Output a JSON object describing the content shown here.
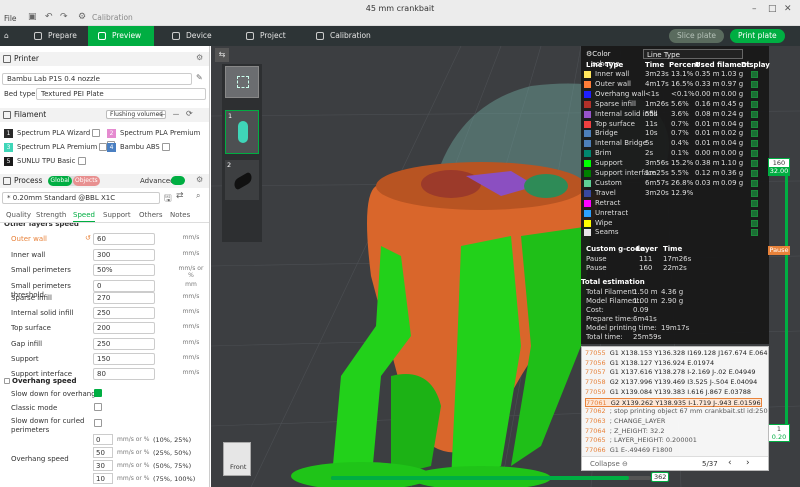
{
  "window": {
    "title": "45 mm crankbait",
    "menu": "File",
    "controls": [
      "–",
      "□",
      "✕"
    ]
  },
  "tabs": [
    {
      "label": "Prepare",
      "active": false
    },
    {
      "label": "Preview",
      "active": true
    },
    {
      "label": "Device",
      "active": false
    },
    {
      "label": "Project",
      "active": false
    },
    {
      "label": "Calibration",
      "active": false
    }
  ],
  "actions": {
    "slice_plate": "Slice plate",
    "print_plate": "Print plate"
  },
  "printer": {
    "section": "Printer",
    "name": "Bambu Lab P1S 0.4 nozzle",
    "bed_type_label": "Bed type",
    "bed_type": "Textured PEI Plate"
  },
  "filament": {
    "section": "Filament",
    "flushing_label": "Flushing volumes",
    "items": [
      {
        "num": "1",
        "name": "Spectrum PLA Wizard",
        "color": "#2a2a2a"
      },
      {
        "num": "2",
        "name": "Spectrum PLA Premium",
        "color": "#e58bd0"
      },
      {
        "num": "3",
        "name": "Spectrum PLA Premium",
        "color": "#3fd6b8"
      },
      {
        "num": "4",
        "name": "Bambu ABS",
        "color": "#4a7fc1"
      },
      {
        "num": "5",
        "name": "SUNLU TPU Basic",
        "color": "#1a1a1a"
      }
    ]
  },
  "process": {
    "section": "Process",
    "toggle_global": "Global",
    "toggle_objects": "Objects",
    "advanced_label": "Advanced",
    "profile": "* 0.20mm Standard @BBL X1C",
    "tabs": [
      "Quality",
      "Strength",
      "Speed",
      "Support",
      "Others",
      "Notes"
    ],
    "active_tab": "Speed"
  },
  "speed": {
    "group": "Other layers speed",
    "rows": [
      {
        "name": "Outer wall",
        "value": "60",
        "unit": "mm/s",
        "modified": true
      },
      {
        "name": "Inner wall",
        "value": "300",
        "unit": "mm/s"
      },
      {
        "name": "Small perimeters",
        "value": "50%",
        "unit": "mm/s or %"
      },
      {
        "name": "Small perimeters threshold",
        "value": "0",
        "unit": "mm"
      },
      {
        "name": "Sparse infill",
        "value": "270",
        "unit": "mm/s"
      },
      {
        "name": "Internal solid infill",
        "value": "250",
        "unit": "mm/s"
      },
      {
        "name": "Top surface",
        "value": "200",
        "unit": "mm/s"
      },
      {
        "name": "Gap infill",
        "value": "250",
        "unit": "mm/s"
      },
      {
        "name": "Support",
        "value": "150",
        "unit": "mm/s"
      },
      {
        "name": "Support interface",
        "value": "80",
        "unit": "mm/s"
      }
    ]
  },
  "overhang": {
    "group": "Overhang speed",
    "slow_down": "Slow down for overhangs",
    "classic": "Classic mode",
    "curled": "Slow down for curled perimeters",
    "label": "Overhang speed",
    "rows": [
      {
        "value": "0",
        "unit": "mm/s or %",
        "range": "(10%, 25%)"
      },
      {
        "value": "50",
        "unit": "mm/s or %",
        "range": "(25%, 50%)"
      },
      {
        "value": "30",
        "unit": "mm/s or %",
        "range": "(50%, 75%)"
      },
      {
        "value": "10",
        "unit": "mm/s or %",
        "range": "(75%, 100%)"
      }
    ]
  },
  "legend": {
    "scheme_label": "Color scheme",
    "scheme": "Line Type",
    "headers": [
      "Line Type",
      "Time",
      "Percent",
      "Used filament",
      "Display"
    ],
    "rows": [
      {
        "name": "Inner wall",
        "time": "3m23s",
        "pct": "13.1%",
        "len": "0.35 m",
        "g": "1.03 g",
        "color": "#ffe65c"
      },
      {
        "name": "Outer wall",
        "time": "4m17s",
        "pct": "16.5%",
        "len": "0.33 m",
        "g": "0.97 g",
        "color": "#ff7d38"
      },
      {
        "name": "Overhang wall",
        "time": "<1s",
        "pct": "<0.1%",
        "len": "0.00 m",
        "g": "0.00 g",
        "color": "#1f1fff"
      },
      {
        "name": "Sparse infill",
        "time": "1m26s",
        "pct": "5.6%",
        "len": "0.16 m",
        "g": "0.45 g",
        "color": "#b03029"
      },
      {
        "name": "Internal solid infill",
        "time": "55s",
        "pct": "3.6%",
        "len": "0.08 m",
        "g": "0.24 g",
        "color": "#9654cc"
      },
      {
        "name": "Top surface",
        "time": "11s",
        "pct": "0.7%",
        "len": "0.01 m",
        "g": "0.04 g",
        "color": "#f04040"
      },
      {
        "name": "Bridge",
        "time": "10s",
        "pct": "0.7%",
        "len": "0.01 m",
        "g": "0.02 g",
        "color": "#4d80ba"
      },
      {
        "name": "Internal Bridge",
        "time": "5s",
        "pct": "0.4%",
        "len": "0.01 m",
        "g": "0.04 g",
        "color": "#4d80ba"
      },
      {
        "name": "Brim",
        "time": "2s",
        "pct": "0.1%",
        "len": "0.00 m",
        "g": "0.00 g",
        "color": "#00876e"
      },
      {
        "name": "Support",
        "time": "3m56s",
        "pct": "15.2%",
        "len": "0.38 m",
        "g": "1.10 g",
        "color": "#00ff00"
      },
      {
        "name": "Support interface",
        "time": "1m25s",
        "pct": "5.5%",
        "len": "0.12 m",
        "g": "0.36 g",
        "color": "#008000"
      },
      {
        "name": "Custom",
        "time": "6m57s",
        "pct": "26.8%",
        "len": "0.03 m",
        "g": "0.09 g",
        "color": "#5ed194"
      },
      {
        "name": "Travel",
        "time": "3m20s",
        "pct": "12.9%",
        "len": "",
        "g": "",
        "color": "#38489e"
      },
      {
        "name": "Retract",
        "time": "",
        "pct": "",
        "len": "",
        "g": "",
        "color": "#ff00ff"
      },
      {
        "name": "Unretract",
        "time": "",
        "pct": "",
        "len": "",
        "g": "",
        "color": "#2ba0ff"
      },
      {
        "name": "Wipe",
        "time": "",
        "pct": "",
        "len": "",
        "g": "",
        "color": "#ffff00"
      },
      {
        "name": "Seams",
        "time": "",
        "pct": "",
        "len": "",
        "g": "",
        "color": "#e6e6e6"
      }
    ],
    "custom_header": [
      "Custom g-code",
      "Layer",
      "Time"
    ],
    "custom": [
      {
        "name": "Pause",
        "layer": "111",
        "time": "17m26s"
      },
      {
        "name": "Pause",
        "layer": "160",
        "time": "22m2s"
      }
    ],
    "estimation_title": "Total estimation",
    "estimation": [
      {
        "k": "Total Filament:",
        "v": "1.50 m",
        "v2": "4.36 g"
      },
      {
        "k": "Model Filament:",
        "v": "1.00 m",
        "v2": "2.90 g"
      },
      {
        "k": "Cost:",
        "v": "0.09",
        "v2": ""
      },
      {
        "k": "Prepare time:",
        "v": "6m41s",
        "v2": ""
      },
      {
        "k": "Model printing time:",
        "v": "19m17s",
        "v2": ""
      },
      {
        "k": "Total time:",
        "v": "25m59s",
        "v2": ""
      }
    ]
  },
  "gcode": {
    "lines": [
      {
        "n": "77055",
        "t": "G1 X138.153 Y136.328 I169.128 J167.674 E.06424"
      },
      {
        "n": "77056",
        "t": "G1 X138.127 Y136.924 E.01974"
      },
      {
        "n": "77057",
        "t": "G1 X137.616 Y138.278 I-2.169 J-.02 E.04949"
      },
      {
        "n": "77058",
        "t": "G2 X137.996 Y139.469 I3.525 J-.504 E.04094"
      },
      {
        "n": "77059",
        "t": "G1 X139.084 Y139.383 I.616 J.867 E.03788"
      },
      {
        "n": "77061",
        "t": "G2 X139.262 Y138.935 I-1.719 J-.943 E.01596"
      },
      {
        "n": "77062",
        "t": "; stop printing object 67 mm crankbait.stl id:250720"
      },
      {
        "n": "77063",
        "t": "; CHANGE_LAYER"
      },
      {
        "n": "77064",
        "t": "; Z_HEIGHT: 32.2"
      },
      {
        "n": "77065",
        "t": "; LAYER_HEIGHT: 0.200001"
      },
      {
        "n": "77066",
        "t": "G1 E-.49469 F1800"
      }
    ],
    "collapse": "Collapse",
    "page": "5/37"
  },
  "slider": {
    "top_layer": "160",
    "top_height": "32.00",
    "pause_label": "Pause",
    "bottom_layer": "1",
    "bottom_height": "0.20",
    "move_value": "362",
    "progress": 0.93
  },
  "viewcube": {
    "front": "Front"
  },
  "plates": [
    "1",
    "2"
  ],
  "colors": {
    "accent": "#00ae42",
    "tabbar": "#2d3436",
    "viewport": "#3c3e41",
    "model_orange": "#d9662b",
    "support_green": "#22d11a"
  }
}
